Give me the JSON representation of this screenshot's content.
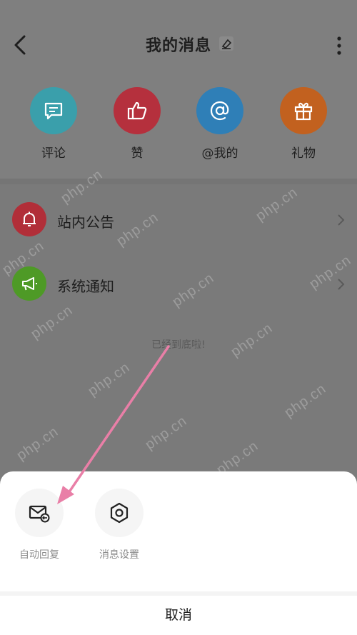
{
  "header": {
    "title": "我的消息"
  },
  "categories": [
    {
      "label": "评论",
      "color": "#3a9fab",
      "icon": "comment-icon"
    },
    {
      "label": "赞",
      "color": "#b5303d",
      "icon": "thumbs-up-icon"
    },
    {
      "label": "@我的",
      "color": "#2f7fb7",
      "icon": "at-icon"
    },
    {
      "label": "礼物",
      "color": "#c2611f",
      "icon": "gift-icon"
    }
  ],
  "list": [
    {
      "label": "站内公告",
      "color": "#b12e38",
      "icon": "bell-icon"
    },
    {
      "label": "系统通知",
      "color": "#4e9a26",
      "icon": "megaphone-icon"
    }
  ],
  "end_text": "已经到底啦!",
  "watermark": "php.cn",
  "sheet": {
    "actions": [
      {
        "label": "自动回复",
        "icon": "mail-reply-icon"
      },
      {
        "label": "消息设置",
        "icon": "settings-hexagon-icon"
      }
    ],
    "cancel": "取消"
  },
  "colors": {
    "overlay": "#7c7c7c",
    "arrow": "#e97fa7"
  }
}
